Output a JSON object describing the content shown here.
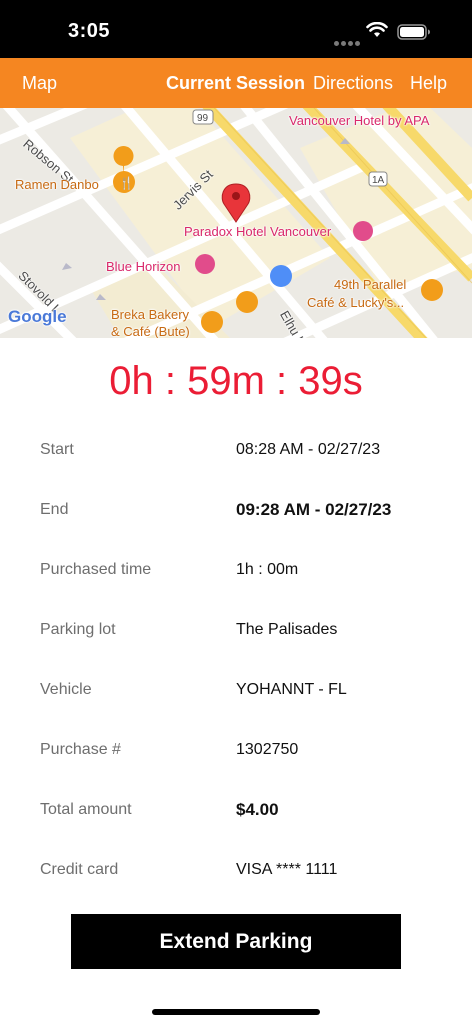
{
  "status_bar": {
    "time": "3:05",
    "wifi_icon": "wifi-icon",
    "battery_icon": "battery-icon"
  },
  "nav": {
    "map": "Map",
    "current_session": "Current Session",
    "directions": "Directions",
    "help": "Help",
    "background_color": "#F58621"
  },
  "map": {
    "labels": {
      "robson_st": "Robson St",
      "ramen_danbo": "Ramen Danbo",
      "jervis_st": "Jervis St",
      "paradox_hotel": "Paradox Hotel Vancouver",
      "vancouver_hotel": "Vancouver Hotel by APA",
      "blue_horizon": "Blue Horizon",
      "parallel_cafe_line1": "49th Parallel",
      "parallel_cafe_line2": "Café & Lucky's...",
      "breka_line1": "Breka Bakery",
      "breka_line2": "& Café (Bute)",
      "stovold": "Stovold L",
      "elhu": "Elhu L",
      "route_99": "99",
      "route_1a": "1A",
      "google": "Google"
    }
  },
  "timer": {
    "text": "0h : 59m : 39s",
    "color": "#EB1D35"
  },
  "details": [
    {
      "label": "Start",
      "value": "08:28 AM - 02/27/23",
      "bold": false
    },
    {
      "label": "End",
      "value": "09:28 AM - 02/27/23",
      "bold": true
    },
    {
      "label": "Purchased time",
      "value": "1h : 00m",
      "bold": false
    },
    {
      "label": "Parking lot",
      "value": "The Palisades",
      "bold": false
    },
    {
      "label": "Vehicle",
      "value": "YOHANNT - FL",
      "bold": false
    },
    {
      "label": "Purchase #",
      "value": "1302750",
      "bold": false
    },
    {
      "label": "Total amount",
      "value": "$4.00",
      "bold": true
    },
    {
      "label": "Credit card",
      "value": "VISA **** 1111",
      "bold": false
    }
  ],
  "extend_button": {
    "label": "Extend Parking"
  }
}
